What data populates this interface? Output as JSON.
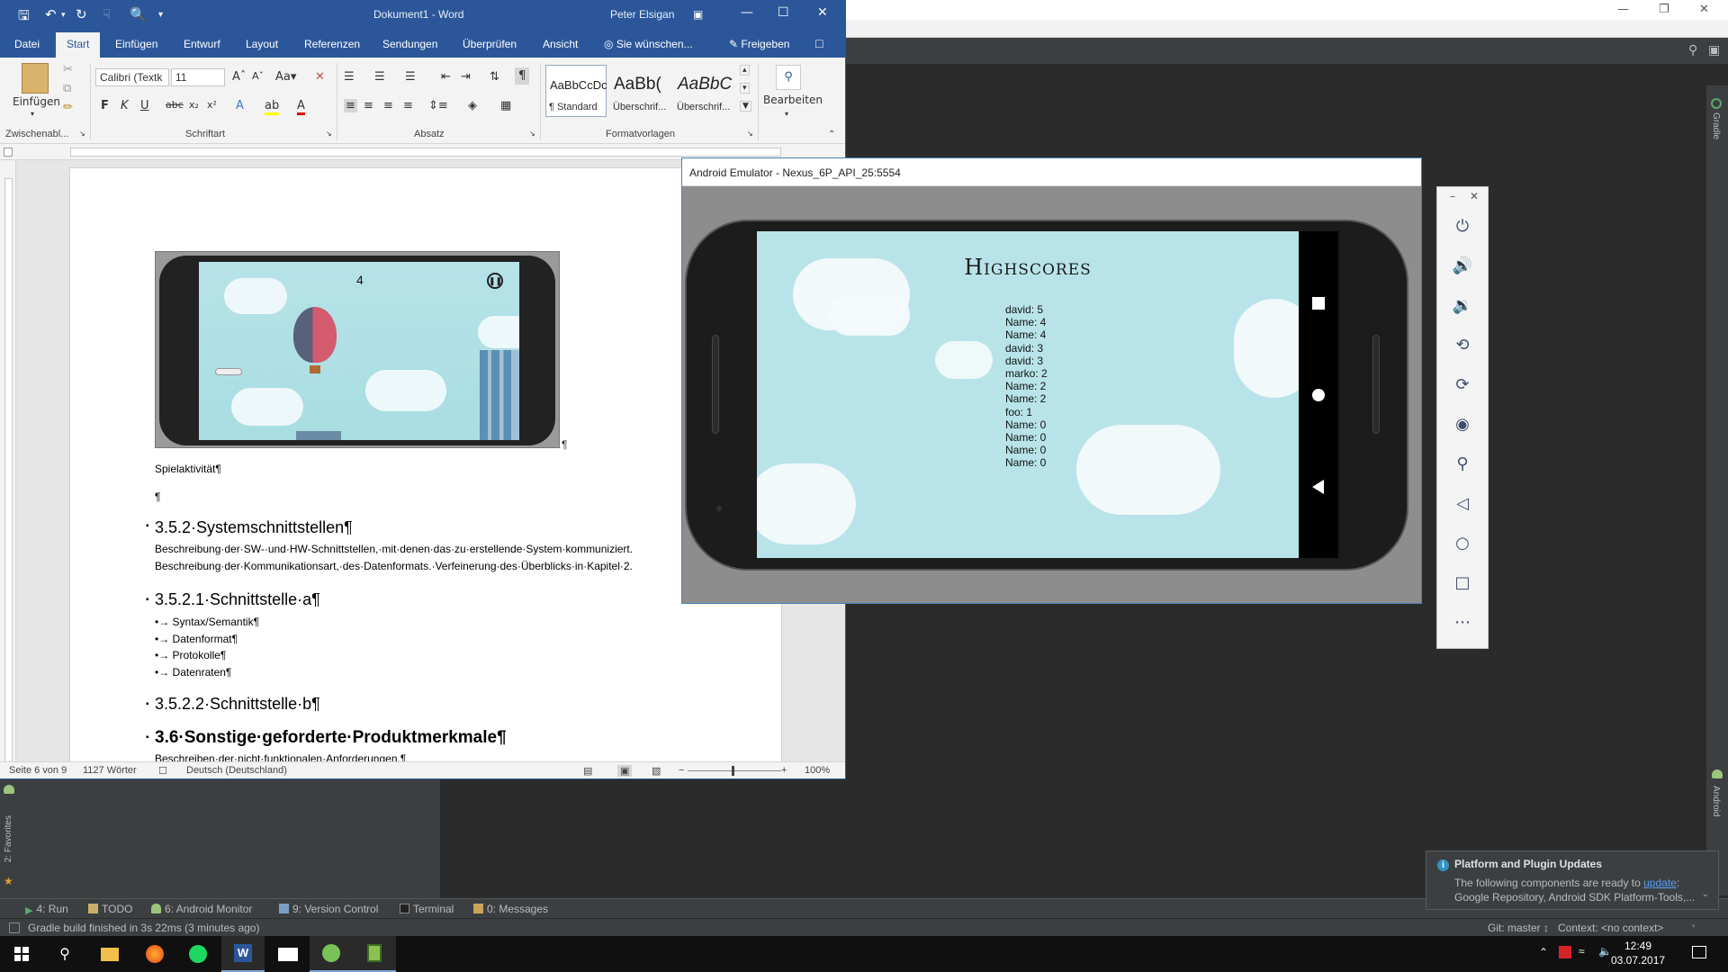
{
  "studio": {
    "tool_tabs": [
      {
        "label": "4: Run"
      },
      {
        "label": "TODO"
      },
      {
        "label": "6: Android Monitor"
      },
      {
        "label": "9: Version Control"
      },
      {
        "label": "Terminal"
      },
      {
        "label": "0: Messages"
      }
    ],
    "status_message": "Gradle build finished in 3s 22ms (3 minutes ago)",
    "git_status": "Git: master ↕",
    "context": "Context: <no context>",
    "left_strip_label": "2: Favorites",
    "right_strip_top": "Gradle",
    "right_strip_bottom": "Android",
    "notification": {
      "title": "Platform and Plugin Updates",
      "body_line1_prefix": "The following components are ready to ",
      "body_link": "update",
      "body_line1_suffix": ":",
      "body_line2": "Google Repository, Android SDK Platform-Tools,..."
    }
  },
  "word": {
    "title": "Dokument1 - Word",
    "user": "Peter Elsigan",
    "tabs": [
      "Datei",
      "Start",
      "Einfügen",
      "Entwurf",
      "Layout",
      "Referenzen",
      "Sendungen",
      "Überprüfen",
      "Ansicht"
    ],
    "tell_me": "Sie wünschen...",
    "share": "Freigeben",
    "ribbon": {
      "paste_label": "Einfügen",
      "font_name": "Calibri (Textk",
      "font_size": "11",
      "styles": [
        {
          "sample": "AaBbCcDc",
          "name": "¶ Standard"
        },
        {
          "sample": "AaBb(",
          "name": "Überschrif..."
        },
        {
          "sample": "AaBbC",
          "name": "Überschrif..."
        }
      ],
      "edit_label": "Bearbeiten",
      "groups": [
        "Zwischenabl...",
        "Schriftart",
        "Absatz",
        "Formatvorlagen"
      ]
    },
    "document": {
      "caption": "Spielaktivität¶",
      "empty_para": "¶",
      "h_352": "3.5.2·Systemschnittstellen¶",
      "p_352_1": "Beschreibung·der·SW-·und·HW-Schnittstellen,·mit·denen·das·zu·erstellende·System·kommuniziert.",
      "p_352_2": "Beschreibung·der·Kommunikationsart,·des·Datenformats.·Verfeinerung·des·Überblicks·in·Kapitel·2.",
      "h_3521": "3.5.2.1·Schnittstelle·a¶",
      "bullets": [
        "Syntax/Semantik¶",
        "Datenformat¶",
        "Protokolle¶",
        "Datenraten¶"
      ],
      "h_3522": "3.5.2.2·Schnittstelle·b¶",
      "h_36": "3.6·Sonstige·geforderte·Produktmerkmale¶",
      "p_36": "Beschreiben·der·nicht·funktionalen·Anforderungen.¶",
      "score": "4",
      "image_pilcrow": "¶"
    },
    "status": {
      "page": "Seite 6 von 9",
      "words": "1127 Wörter",
      "language": "Deutsch (Deutschland)",
      "zoom": "100%"
    }
  },
  "emulator": {
    "title": "Android Emulator - Nexus_6P_API_25:5554",
    "highscores_title": "Highscores",
    "scores": [
      "david: 5",
      "Name: 4",
      "Name: 4",
      "david: 3",
      "david: 3",
      "marko: 2",
      "Name: 2",
      "Name: 2",
      "foo: 1",
      "Name: 0",
      "Name: 0",
      "Name: 0",
      "Name: 0"
    ],
    "sidebar_buttons": [
      "power-icon",
      "volume-up-icon",
      "volume-down-icon",
      "rotate-left-icon",
      "rotate-right-icon",
      "camera-icon",
      "zoom-icon",
      "back-icon",
      "home-icon",
      "overview-icon",
      "more-icon"
    ]
  },
  "taskbar": {
    "time": "12:49",
    "date": "03.07.2017"
  },
  "colors": {
    "word_blue": "#2b579a",
    "studio_dark": "#2b2b2b",
    "studio_panel": "#3c3f41",
    "sky": "#b8e4e9"
  }
}
